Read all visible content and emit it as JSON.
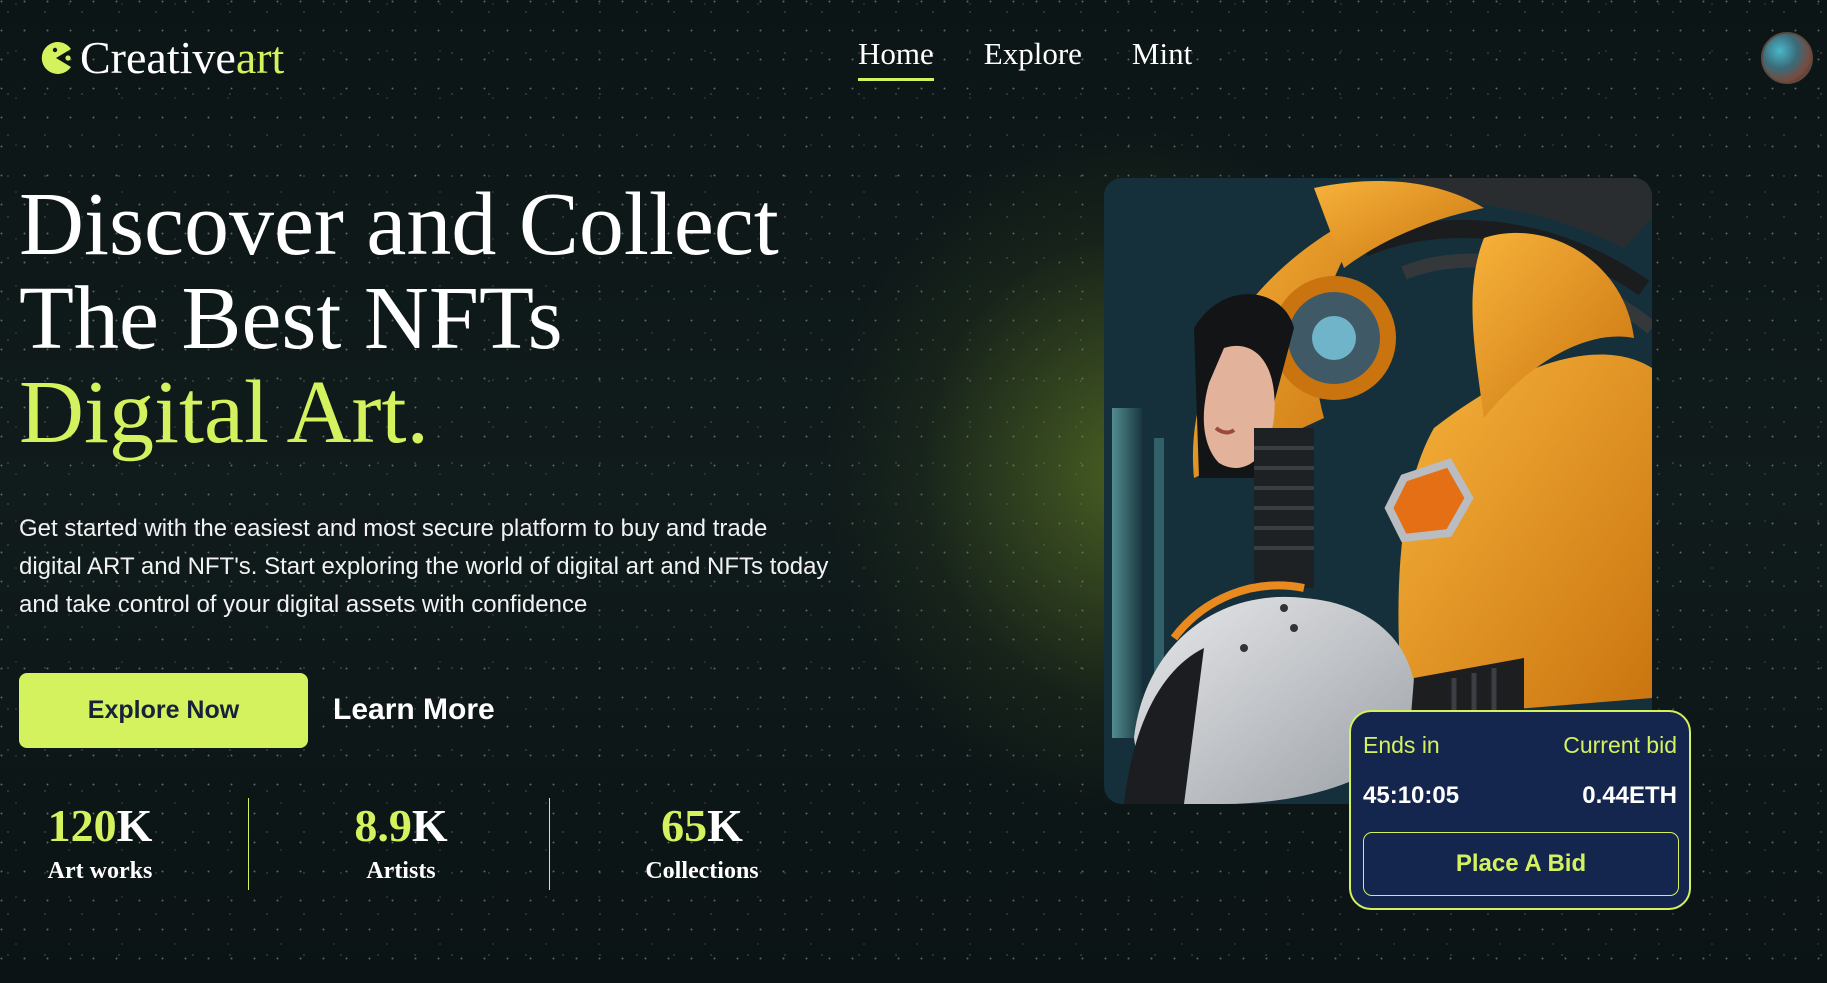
{
  "brand": {
    "name_main": "Creative",
    "name_accent": "art",
    "icon": "pacman-logo-icon"
  },
  "nav": {
    "items": [
      {
        "label": "Home",
        "active": true
      },
      {
        "label": "Explore",
        "active": false
      },
      {
        "label": "Mint",
        "active": false
      }
    ]
  },
  "header": {
    "avatar_icon": "user-avatar"
  },
  "hero": {
    "title_line1": "Discover and Collect",
    "title_line2": "The Best NFTs",
    "title_line3": "Digital Art.",
    "description": "Get started with the easiest and most secure platform to buy and trade digital ART and NFT's. Start exploring the world of digital art and NFTs today and take control of your digital assets with confidence",
    "primary_button": "Explore Now",
    "secondary_button": "Learn More"
  },
  "stats": [
    {
      "number": "120",
      "suffix": "K",
      "label": "Art works"
    },
    {
      "number": "8.9",
      "suffix": "K",
      "label": "Artists"
    },
    {
      "number": "65",
      "suffix": "K",
      "label": "Collections"
    }
  ],
  "bid": {
    "ends_label": "Ends in",
    "bid_label": "Current bid",
    "ends_value": "45:10:05",
    "bid_value": "0.44ETH",
    "button": "Place A Bid"
  },
  "colors": {
    "accent": "#d4f15e",
    "card_bg": "#15264e",
    "background": "#0f1a1b"
  }
}
